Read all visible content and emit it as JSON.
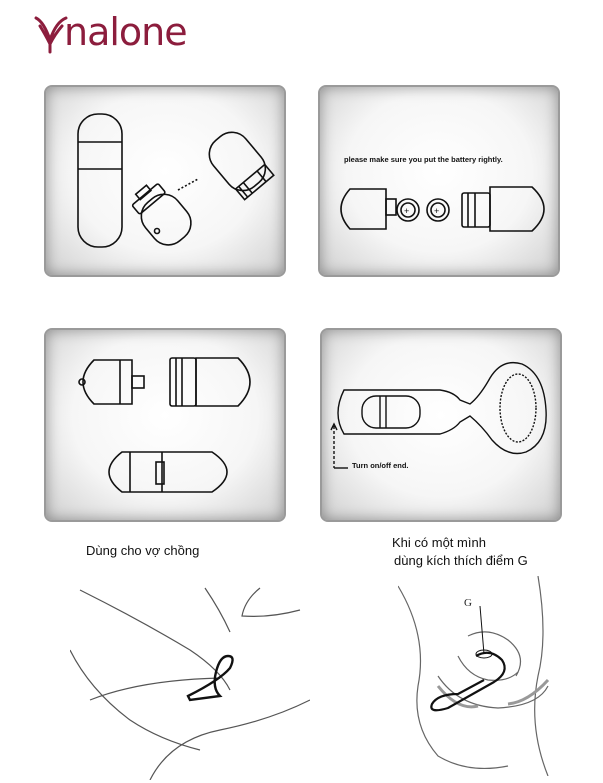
{
  "brand": {
    "name": "nalone",
    "color": "#8c1d3d"
  },
  "panels": {
    "battery_note": "please make sure you put the battery rightly.",
    "turn_note": "Turn on/off end."
  },
  "captions": {
    "left": "Dùng  cho vợ chồng",
    "right_line1": "Khi có một mình",
    "right_line2": "dùng kích thích điểm G"
  },
  "illustration": {
    "g_label": "G"
  }
}
